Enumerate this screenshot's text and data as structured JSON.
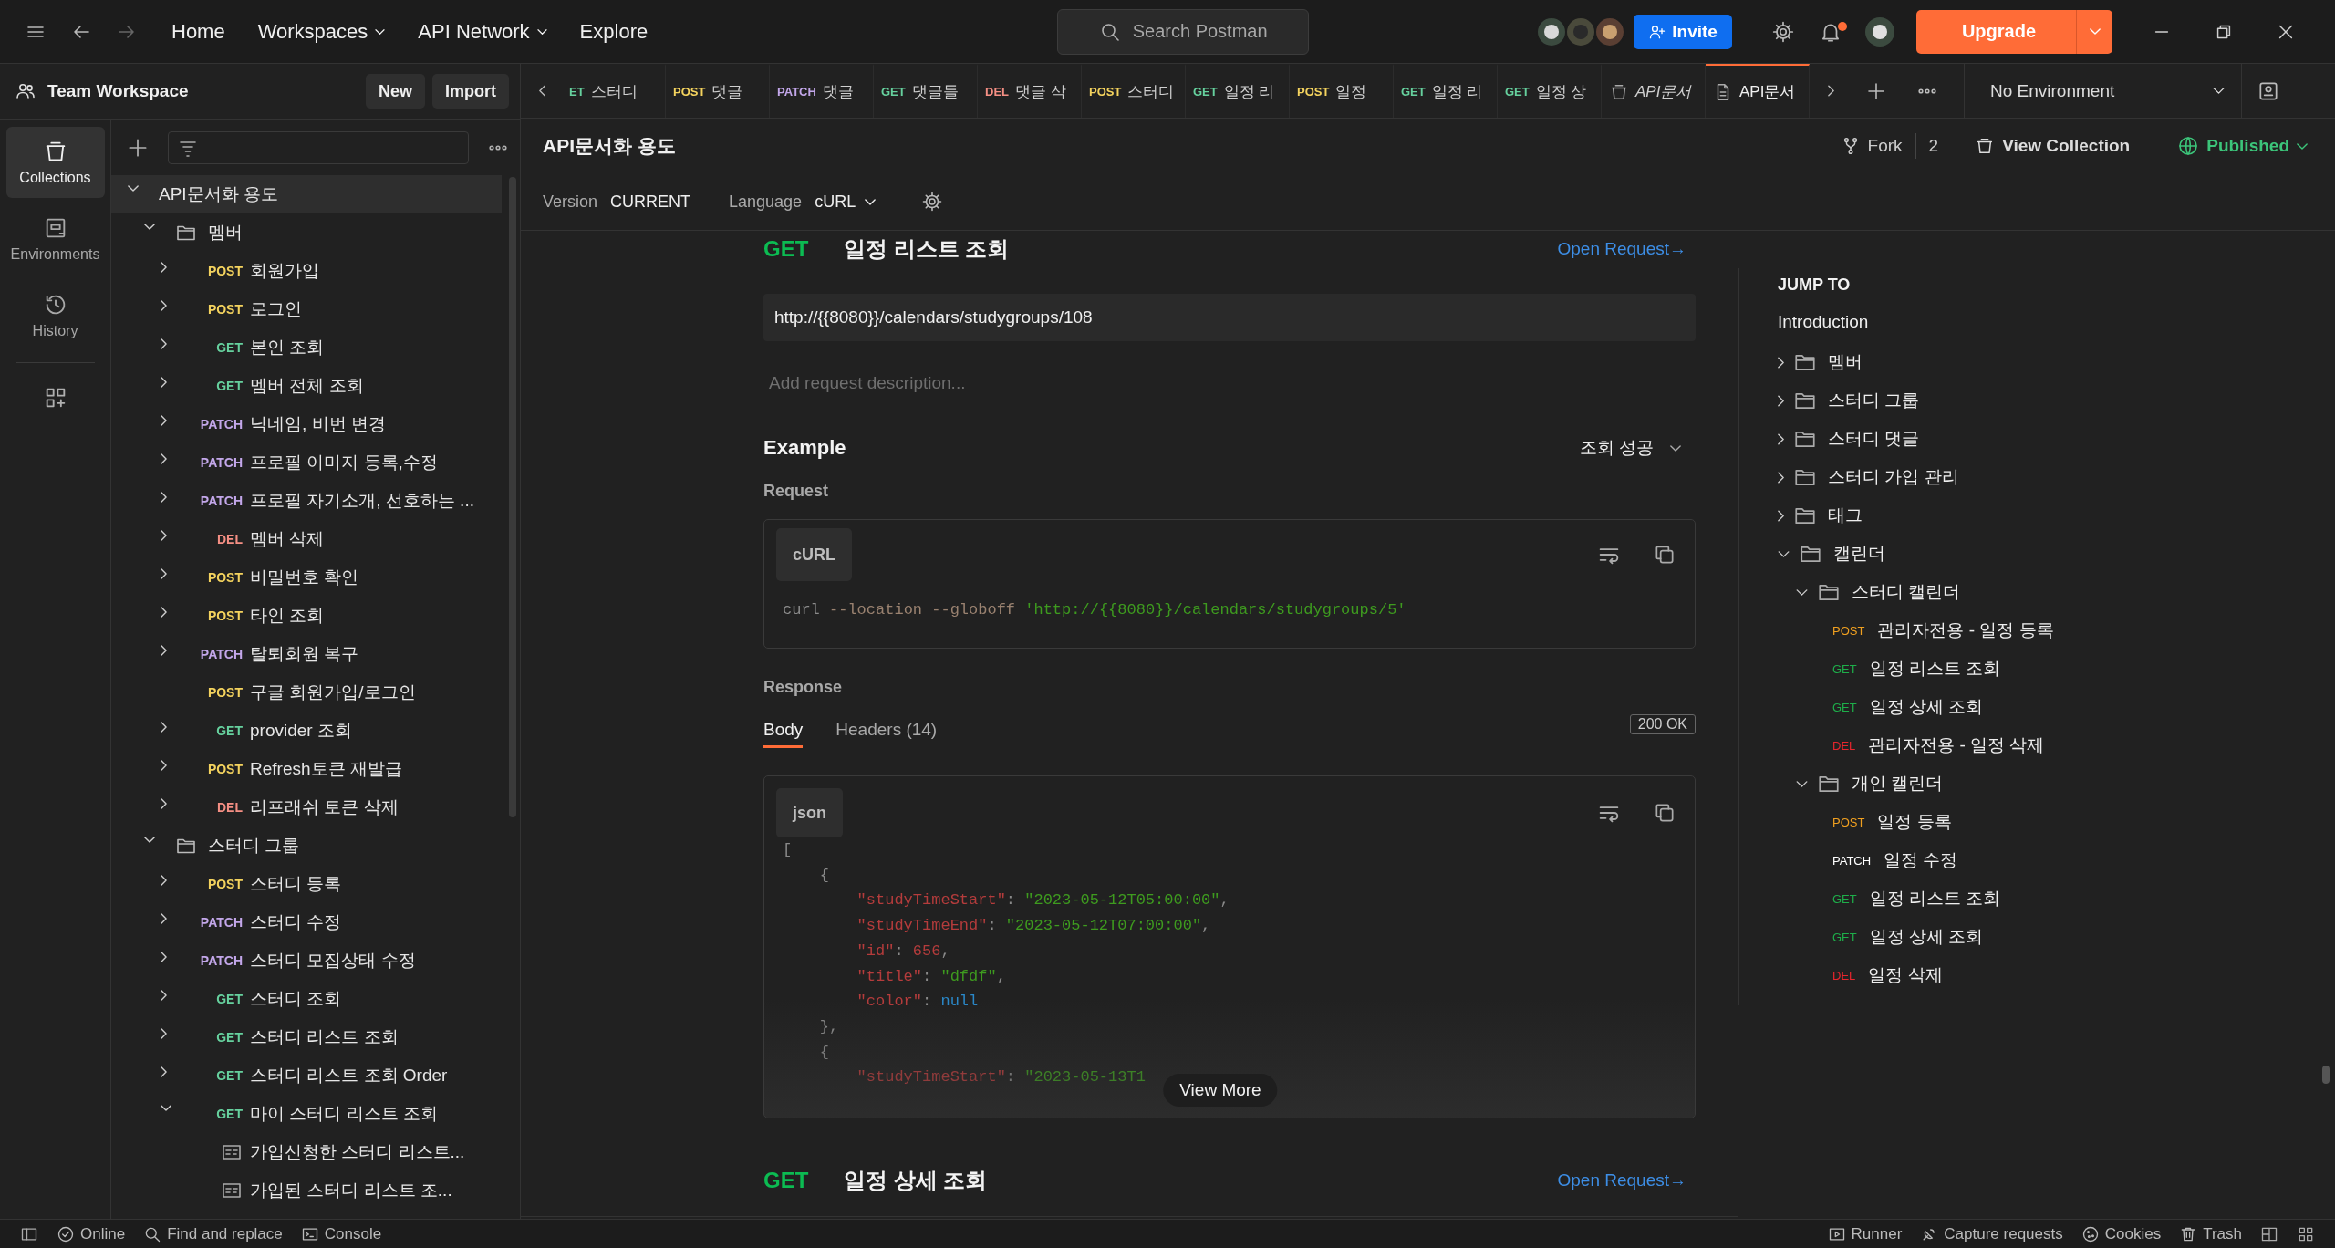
{
  "topbar": {
    "nav": [
      {
        "label": "Home",
        "dropdown": false
      },
      {
        "label": "Workspaces",
        "dropdown": true
      },
      {
        "label": "API Network",
        "dropdown": true
      },
      {
        "label": "Explore",
        "dropdown": false
      }
    ],
    "search": {
      "placeholder": "Search Postman"
    },
    "invite": "Invite",
    "notification": true,
    "upgrade": "Upgrade"
  },
  "workspace": {
    "name": "Team Workspace",
    "buttons": [
      "New",
      "Import"
    ]
  },
  "rail": [
    {
      "label": "Collections",
      "selected": true
    },
    {
      "label": "Environments",
      "selected": false
    },
    {
      "label": "History",
      "selected": false
    }
  ],
  "tree": [
    {
      "kind": "collection",
      "name": "API문서화 용도",
      "expanded": true,
      "selected": true,
      "children": [
        {
          "kind": "folder",
          "name": "멤버",
          "expanded": true,
          "selected": false,
          "children": [
            {
              "kind": "request",
              "method": "POST",
              "name": "회원가입",
              "expanded": false,
              "selected": false
            },
            {
              "kind": "request",
              "method": "POST",
              "name": "로그인",
              "expanded": false,
              "selected": false
            },
            {
              "kind": "request",
              "method": "GET",
              "name": "본인 조회",
              "expanded": false,
              "selected": false
            },
            {
              "kind": "request",
              "method": "GET",
              "name": "멤버 전체 조회",
              "expanded": false,
              "selected": false
            },
            {
              "kind": "request",
              "method": "PATCH",
              "name": "닉네임, 비번 변경",
              "expanded": false,
              "selected": false
            },
            {
              "kind": "request",
              "method": "PATCH",
              "name": "프로필 이미지 등록,수정",
              "expanded": false,
              "selected": false
            },
            {
              "kind": "request",
              "method": "PATCH",
              "name": "프로필 자기소개, 선호하는 ...",
              "expanded": false,
              "selected": false
            },
            {
              "kind": "request",
              "method": "DEL",
              "name": "멤버 삭제",
              "expanded": false,
              "selected": false
            },
            {
              "kind": "request",
              "method": "POST",
              "name": "비밀번호 확인",
              "expanded": false,
              "selected": false
            },
            {
              "kind": "request",
              "method": "POST",
              "name": "타인 조회",
              "expanded": false,
              "selected": false
            },
            {
              "kind": "request",
              "method": "PATCH",
              "name": "탈퇴회원 복구",
              "expanded": false,
              "selected": false
            },
            {
              "kind": "request",
              "method": "POST",
              "name": "구글 회원가입/로그인",
              "leaf": true,
              "selected": false
            },
            {
              "kind": "request",
              "method": "GET",
              "name": "provider 조회",
              "expanded": false,
              "selected": false
            },
            {
              "kind": "request",
              "method": "POST",
              "name": "Refresh토큰 재발급",
              "expanded": false,
              "selected": false
            },
            {
              "kind": "request",
              "method": "DEL",
              "name": "리프래쉬 토큰 삭제",
              "expanded": false,
              "selected": false
            }
          ]
        },
        {
          "kind": "folder",
          "name": "스터디 그룹",
          "expanded": true,
          "selected": false,
          "children": [
            {
              "kind": "request",
              "method": "POST",
              "name": "스터디 등록",
              "expanded": false,
              "selected": false
            },
            {
              "kind": "request",
              "method": "PATCH",
              "name": "스터디 수정",
              "expanded": false,
              "selected": false
            },
            {
              "kind": "request",
              "method": "PATCH",
              "name": "스터디 모집상태 수정",
              "expanded": false,
              "selected": false
            },
            {
              "kind": "request",
              "method": "GET",
              "name": "스터디 조회",
              "expanded": false,
              "selected": false
            },
            {
              "kind": "request",
              "method": "GET",
              "name": "스터디 리스트 조회",
              "expanded": false,
              "selected": false
            },
            {
              "kind": "request",
              "method": "GET",
              "name": "스터디 리스트 조회 Order",
              "expanded": false,
              "selected": false
            },
            {
              "kind": "request",
              "method": "GET",
              "name": "마이 스터디 리스트 조회",
              "expanded": true,
              "selected": false,
              "children": [
                {
                  "kind": "example",
                  "name": "가입신청한 스터디 리스트...",
                  "selected": false
                },
                {
                  "kind": "example",
                  "name": "가입된 스터디 리스트 조...",
                  "selected": false
                }
              ]
            }
          ]
        }
      ]
    }
  ],
  "tabs": [
    {
      "kind": "request",
      "method": "ET",
      "name": "스터디",
      "selected": false
    },
    {
      "kind": "request",
      "method": "POST",
      "name": "댓글",
      "selected": false
    },
    {
      "kind": "request",
      "method": "PATCH",
      "name": "댓글",
      "selected": false
    },
    {
      "kind": "request",
      "method": "GET",
      "name": "댓글들",
      "selected": false
    },
    {
      "kind": "request",
      "method": "DEL",
      "name": "댓글 삭",
      "selected": false
    },
    {
      "kind": "request",
      "method": "POST",
      "name": "스터디",
      "selected": false
    },
    {
      "kind": "request",
      "method": "GET",
      "name": "일정 리",
      "selected": false
    },
    {
      "kind": "request",
      "method": "POST",
      "name": "일정",
      "selected": false
    },
    {
      "kind": "request",
      "method": "GET",
      "name": "일정 리",
      "selected": false
    },
    {
      "kind": "request",
      "method": "GET",
      "name": "일정 상",
      "selected": false
    },
    {
      "kind": "collection_preview",
      "name": "API문서",
      "selected": false
    },
    {
      "kind": "document",
      "name": "API문서",
      "selected": true
    }
  ],
  "environment": "No Environment",
  "collection": {
    "title": "API문서화 용도",
    "fork": "Fork",
    "fork_count": "2",
    "view": "View Collection",
    "published": "Published",
    "version_label": "Version",
    "version": "CURRENT",
    "language_label": "Language",
    "language": "cURL"
  },
  "requests": [
    {
      "method": "GET",
      "name": "일정 리스트 조회",
      "link": "Open Request→",
      "url": "http://{{8080}}/calendars/studygroups/108",
      "placeholder": "Add request description...",
      "example": {
        "title": "Example",
        "choice": "조회 성공",
        "request_label": "Request",
        "request_lang": "cURL",
        "request_code": [
          [
            {
              "text": "curl",
              "kind": "plain"
            },
            {
              "text": " --location",
              "kind": "flag"
            },
            {
              "text": " --globoff",
              "kind": "flag"
            },
            {
              "text": " 'http://{{8080}}/calendars/studygroups/5'",
              "kind": "string"
            }
          ]
        ],
        "response_label": "Response",
        "response_tabs": [
          {
            "label": "Body",
            "selected": true
          },
          {
            "label": "Headers (14)",
            "selected": false
          }
        ],
        "status": "200 OK",
        "response_lang": "json",
        "response_code": [
          [
            {
              "text": "[",
              "kind": "punct"
            }
          ],
          [
            {
              "text": "    {",
              "kind": "punct"
            }
          ],
          [
            {
              "text": "        \"studyTimeStart\"",
              "kind": "key"
            },
            {
              "text": ": ",
              "kind": "punct"
            },
            {
              "text": "\"2023-05-12T05:00:00\"",
              "kind": "string"
            },
            {
              "text": ",",
              "kind": "punct"
            }
          ],
          [
            {
              "text": "        \"studyTimeEnd\"",
              "kind": "key"
            },
            {
              "text": ": ",
              "kind": "punct"
            },
            {
              "text": "\"2023-05-12T07:00:00\"",
              "kind": "string"
            },
            {
              "text": ",",
              "kind": "punct"
            }
          ],
          [
            {
              "text": "        \"id\"",
              "kind": "key"
            },
            {
              "text": ": ",
              "kind": "punct"
            },
            {
              "text": "656",
              "kind": "number"
            },
            {
              "text": ",",
              "kind": "punct"
            }
          ],
          [
            {
              "text": "        \"title\"",
              "kind": "key"
            },
            {
              "text": ": ",
              "kind": "punct"
            },
            {
              "text": "\"dfdf\"",
              "kind": "string"
            },
            {
              "text": ",",
              "kind": "punct"
            }
          ],
          [
            {
              "text": "        \"color\"",
              "kind": "key"
            },
            {
              "text": ": ",
              "kind": "punct"
            },
            {
              "text": "null",
              "kind": "null"
            }
          ],
          [
            {
              "text": "    },",
              "kind": "punct"
            }
          ],
          [
            {
              "text": "    {",
              "kind": "punct"
            }
          ],
          [
            {
              "text": "        \"studyTimeStart\"",
              "kind": "key"
            },
            {
              "text": ": ",
              "kind": "punct"
            },
            {
              "text": "\"2023-05-13T1",
              "kind": "string"
            }
          ]
        ],
        "more": "View More"
      }
    },
    {
      "method": "GET",
      "name": "일정 상세 조회",
      "link": "Open Request→"
    }
  ],
  "jump": {
    "title": "JUMP TO",
    "intro": "Introduction",
    "items": [
      {
        "kind": "folder",
        "name": "멤버",
        "expanded": false
      },
      {
        "kind": "folder",
        "name": "스터디 그룹",
        "expanded": false
      },
      {
        "kind": "folder",
        "name": "스터디 댓글",
        "expanded": false
      },
      {
        "kind": "folder",
        "name": "스터디 가입 관리",
        "expanded": false
      },
      {
        "kind": "folder",
        "name": "태그",
        "expanded": false
      },
      {
        "kind": "folder",
        "name": "캘린더",
        "expanded": true,
        "children": [
          {
            "kind": "folder",
            "name": "스터디 캘린더",
            "expanded": true,
            "children": [
              {
                "kind": "request",
                "method": "POST",
                "name": "관리자전용 - 일정 등록"
              },
              {
                "kind": "request",
                "method": "GET",
                "name": "일정 리스트 조회"
              },
              {
                "kind": "request",
                "method": "GET",
                "name": "일정 상세 조회"
              },
              {
                "kind": "request",
                "method": "DEL",
                "name": "관리자전용 - 일정 삭제"
              }
            ]
          },
          {
            "kind": "folder",
            "name": "개인 캘린더",
            "expanded": true,
            "children": [
              {
                "kind": "request",
                "method": "POST",
                "name": "일정 등록"
              },
              {
                "kind": "request",
                "method": "PATCH",
                "name": "일정 수정"
              },
              {
                "kind": "request",
                "method": "GET",
                "name": "일정 리스트 조회"
              },
              {
                "kind": "request",
                "method": "GET",
                "name": "일정 상세 조회"
              },
              {
                "kind": "request",
                "method": "DEL",
                "name": "일정 삭제"
              }
            ]
          }
        ]
      }
    ]
  },
  "status_bar": {
    "left": [
      "Online",
      "Find and replace",
      "Console"
    ],
    "right": [
      "Runner",
      "Capture requests",
      "Cookies",
      "Trash"
    ]
  }
}
